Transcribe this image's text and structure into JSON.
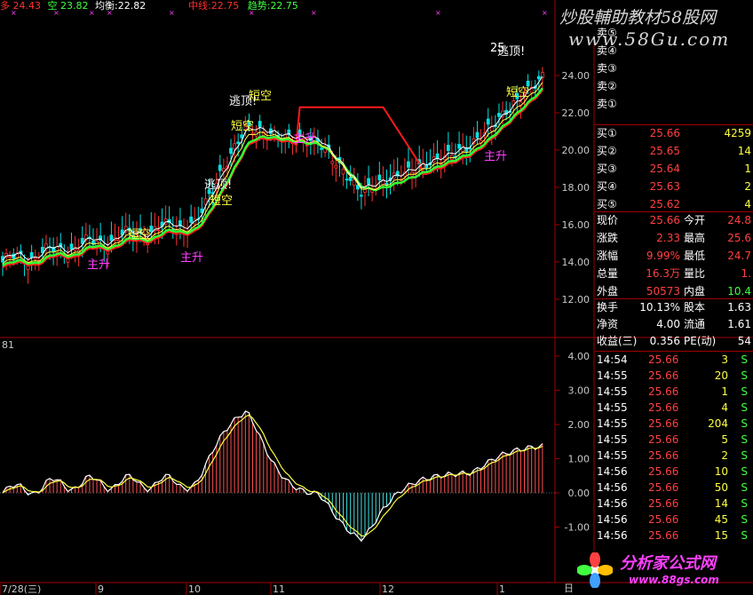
{
  "header": {
    "duo_label": "多",
    "duo_value": "24.43",
    "kong_label": "空",
    "kong_value": "23.82",
    "junheng_label": "均衡:",
    "junheng_value": "22.82",
    "zhongxian_label": "中线:",
    "zhongxian_value": "22.75",
    "qushi_label": "趋势:",
    "qushi_value": "22.75"
  },
  "watermark": {
    "line1": "炒股輔助教材58股网",
    "line2": "www.58Gu.com"
  },
  "logo": {
    "line1": "分析家公式网",
    "line2": "www.88gs.com"
  },
  "price_axis": [
    "24.00",
    "22.00",
    "20.00",
    "18.00",
    "16.00",
    "14.00",
    "12.00"
  ],
  "macd_axis": [
    "4.00",
    "3.00",
    "2.00",
    "1.00",
    "0.00",
    "-1.00"
  ],
  "macd_label": "81",
  "date_axis": [
    "7/28(三)",
    "9",
    "10",
    "11",
    "12",
    "1"
  ],
  "period_label": "日",
  "annotations": [
    {
      "text": "逃顶!",
      "color": "#ffffff"
    },
    {
      "text": "短空",
      "color": "#ffff40"
    },
    {
      "text": "逃顶!",
      "color": "#ffffff"
    },
    {
      "text": "短空",
      "color": "#ffff40"
    },
    {
      "text": "短空",
      "color": "#ffff40"
    },
    {
      "text": "短空",
      "color": "#ffff40"
    },
    {
      "text": "逃顶!",
      "color": "#ffffff"
    },
    {
      "text": "短空",
      "color": "#ffff40"
    },
    {
      "text": "主升",
      "color": "#ff40ff"
    },
    {
      "text": "主升",
      "color": "#ff40ff"
    },
    {
      "text": "主升",
      "color": "#ff40ff"
    },
    {
      "text": "主升",
      "color": "#ff40ff"
    },
    {
      "text": "25",
      "color": "#ffffff"
    }
  ],
  "order_book": {
    "sells": [
      {
        "label": "卖⑤"
      },
      {
        "label": "卖④"
      },
      {
        "label": "卖③"
      },
      {
        "label": "卖②"
      },
      {
        "label": "卖①"
      }
    ],
    "buys": [
      {
        "label": "买①",
        "price": "25.66",
        "vol": "4259"
      },
      {
        "label": "买②",
        "price": "25.65",
        "vol": "14"
      },
      {
        "label": "买③",
        "price": "25.64",
        "vol": "1"
      },
      {
        "label": "买④",
        "price": "25.63",
        "vol": "2"
      },
      {
        "label": "买⑤",
        "price": "25.62",
        "vol": "4"
      }
    ]
  },
  "quote": [
    {
      "l1": "现价",
      "v1": "25.66",
      "l2": "今开",
      "v2": "24.8"
    },
    {
      "l1": "涨跌",
      "v1": "2.33",
      "l2": "最高",
      "v2": "25.6"
    },
    {
      "l1": "涨幅",
      "v1": "9.99%",
      "l2": "最低",
      "v2": "24.7"
    },
    {
      "l1": "总量",
      "v1": "16.3万",
      "l2": "量比",
      "v2": "1."
    },
    {
      "l1": "外盘",
      "v1": "50573",
      "l2": "内盘",
      "v2": "10.4"
    }
  ],
  "fundamentals": [
    {
      "l1": "换手",
      "v1": "10.13%",
      "l2": "股本",
      "v2": "1.63"
    },
    {
      "l1": "净资",
      "v1": "4.00",
      "l2": "流通",
      "v2": "1.61"
    },
    {
      "l1": "收益(三)",
      "v1": "0.356",
      "l2": "PE(动)",
      "v2": "54"
    }
  ],
  "ticks": [
    {
      "time": "14:54",
      "price": "25.66",
      "vol": "3",
      "side": "S"
    },
    {
      "time": "14:55",
      "price": "25.66",
      "vol": "20",
      "side": "S"
    },
    {
      "time": "14:55",
      "price": "25.66",
      "vol": "1",
      "side": "S"
    },
    {
      "time": "14:55",
      "price": "25.66",
      "vol": "4",
      "side": "S"
    },
    {
      "time": "14:55",
      "price": "25.66",
      "vol": "204",
      "side": "S"
    },
    {
      "time": "14:55",
      "price": "25.66",
      "vol": "5",
      "side": "S"
    },
    {
      "time": "14:55",
      "price": "25.66",
      "vol": "2",
      "side": "S"
    },
    {
      "time": "14:56",
      "price": "25.66",
      "vol": "10",
      "side": "S"
    },
    {
      "time": "14:56",
      "price": "25.66",
      "vol": "50",
      "side": "S"
    },
    {
      "time": "14:56",
      "price": "25.66",
      "vol": "14",
      "side": "S"
    },
    {
      "time": "14:56",
      "price": "25.66",
      "vol": "45",
      "side": "S"
    },
    {
      "time": "14:56",
      "price": "25.66",
      "vol": "15",
      "side": "S"
    }
  ],
  "colors": {
    "up": "#ff3232",
    "down": "#00e0e0",
    "grid": "#a00000",
    "text": "#c8c8c8",
    "yellow": "#ffff00",
    "green": "#40ff40",
    "red_line": "#ff0000"
  }
}
